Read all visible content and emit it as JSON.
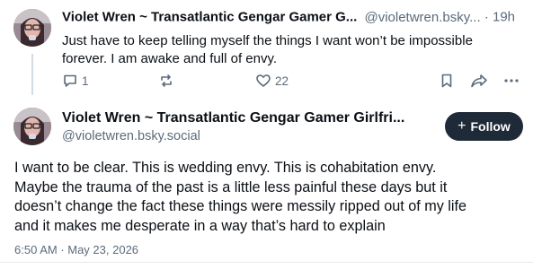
{
  "post1": {
    "display_name": "Violet Wren ~ Transatlantic Gengar Gamer G...",
    "handle": "@violetwren.bsky...",
    "separator": "·",
    "time": "19h",
    "text": "Just have to keep telling myself the things I want won’t be impossible forever. I am awake and full of envy.",
    "reply_count": "1",
    "repost_count": "",
    "like_count": "22",
    "avatar_icon": "avatar-photo"
  },
  "post2": {
    "display_name": "Violet Wren ~ Transatlantic Gengar Gamer Girlfri...",
    "handle": "@violetwren.bsky.social",
    "follow_label": "Follow",
    "text_lines": [
      "I want to be clear. This is wedding envy. This is cohabitation envy.",
      "Maybe the trauma of the past is a little less painful these days but it",
      "doesn’t change the fact these things were messily ripped out of my life",
      "and it makes me desperate in a way that’s hard to explain"
    ],
    "timestamp": "6:50 AM · May 23, 2026",
    "avatar_icon": "avatar-photo"
  },
  "colors": {
    "muted": "#5b6b7b",
    "follow_bg": "#1e2a38",
    "thread_line": "#d4dbe2"
  },
  "icons": [
    "reply-icon",
    "repost-icon",
    "like-icon",
    "bookmark-icon",
    "share-icon",
    "more-icon",
    "plus-icon"
  ]
}
